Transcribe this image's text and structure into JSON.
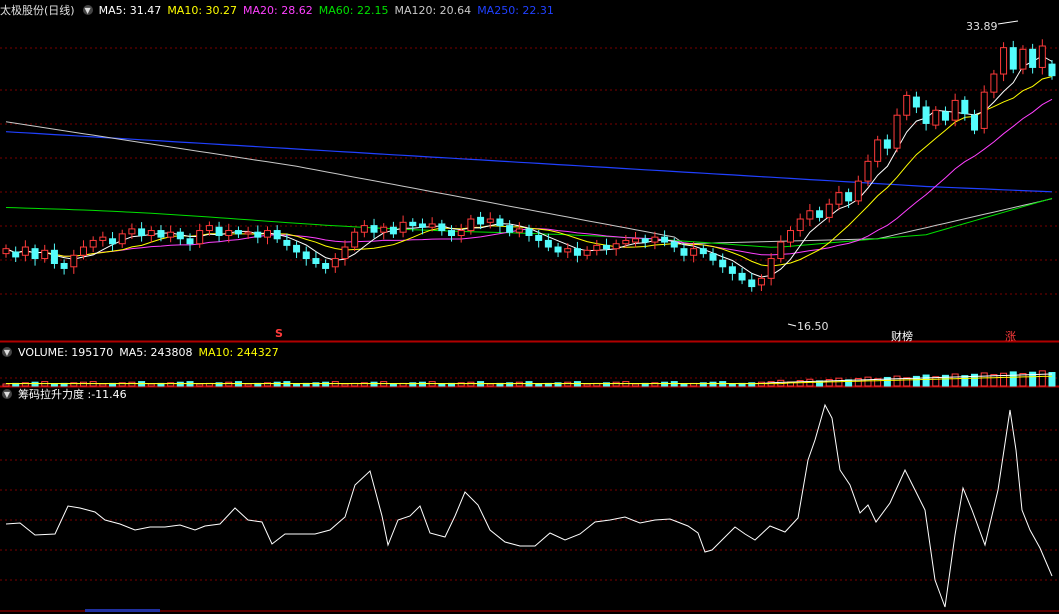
{
  "colors": {
    "up": "#ff3b3b",
    "down": "#54fcfc",
    "ma5": "#ffffff",
    "ma10": "#ffff00",
    "ma20": "#ff40ff",
    "ma60": "#00e000",
    "ma120": "#c8c8c8",
    "ma250": "#2040ff",
    "grid": "#7a0000",
    "separator": "#b00000",
    "osc": "#ffffff"
  },
  "price_panel": {
    "stock_name": "太极股份(日线)",
    "ma_labels": [
      {
        "key": "ma5",
        "text": "MA5: 31.47"
      },
      {
        "key": "ma10",
        "text": "MA10: 30.27"
      },
      {
        "key": "ma20",
        "text": "MA20: 28.62"
      },
      {
        "key": "ma60",
        "text": "MA60: 22.15"
      },
      {
        "key": "ma120",
        "text": "MA120: 20.64"
      },
      {
        "key": "ma250",
        "text": "MA250: 22.31"
      }
    ],
    "high_label": "33.89",
    "low_label": "16.50",
    "markers": [
      {
        "text": "S",
        "color": "#ff3b3b"
      },
      {
        "text": "财榜",
        "color": "#ffffff"
      },
      {
        "text": "涨",
        "color": "#ff3b3b"
      }
    ]
  },
  "volume_panel": {
    "labels": [
      {
        "key": "vol",
        "text": "VOLUME: 195170"
      },
      {
        "key": "ma5",
        "text": "MA5: 243808"
      },
      {
        "key": "ma10",
        "text": "MA10: 244327"
      }
    ]
  },
  "indicator_panel": {
    "label": "筹码拉升力度 :-11.46"
  },
  "chart_data": {
    "type": "candlestick",
    "title": "太极股份(日线)",
    "ylim": [
      15.5,
      34.8
    ],
    "high_point": 33.89,
    "low_point": 16.5,
    "candles": [
      [
        20.5,
        20.8
      ],
      [
        20.6,
        20.3
      ],
      [
        20.4,
        20.9
      ],
      [
        20.8,
        20.2
      ],
      [
        20.2,
        20.7
      ],
      [
        20.7,
        19.9
      ],
      [
        19.9,
        19.6
      ],
      [
        19.7,
        20.4
      ],
      [
        20.4,
        20.9
      ],
      [
        20.9,
        21.3
      ],
      [
        21.3,
        21.5
      ],
      [
        21.4,
        21.1
      ],
      [
        21.1,
        21.7
      ],
      [
        21.7,
        22.0
      ],
      [
        22.0,
        21.6
      ],
      [
        21.6,
        21.9
      ],
      [
        21.9,
        21.5
      ],
      [
        21.5,
        21.8
      ],
      [
        21.8,
        21.4
      ],
      [
        21.4,
        21.1
      ],
      [
        21.1,
        21.9
      ],
      [
        21.9,
        22.2
      ],
      [
        22.1,
        21.6
      ],
      [
        21.6,
        21.9
      ],
      [
        21.9,
        21.7
      ],
      [
        21.7,
        21.8
      ],
      [
        21.8,
        21.5
      ],
      [
        21.5,
        21.9
      ],
      [
        21.9,
        21.4
      ],
      [
        21.3,
        21.0
      ],
      [
        21.0,
        20.6
      ],
      [
        20.6,
        20.2
      ],
      [
        20.2,
        19.9
      ],
      [
        19.9,
        19.6
      ],
      [
        19.7,
        20.2
      ],
      [
        20.2,
        20.9
      ],
      [
        20.9,
        21.8
      ],
      [
        21.8,
        22.2
      ],
      [
        22.2,
        21.8
      ],
      [
        21.8,
        22.1
      ],
      [
        22.1,
        21.7
      ],
      [
        21.8,
        22.4
      ],
      [
        22.4,
        22.2
      ],
      [
        22.3,
        22.1
      ],
      [
        22.1,
        22.3
      ],
      [
        22.3,
        21.9
      ],
      [
        21.9,
        21.6
      ],
      [
        21.6,
        21.9
      ],
      [
        21.9,
        22.6
      ],
      [
        22.7,
        22.3
      ],
      [
        22.4,
        22.6
      ],
      [
        22.6,
        22.2
      ],
      [
        22.2,
        21.8
      ],
      [
        21.8,
        22.0
      ],
      [
        22.0,
        21.6
      ],
      [
        21.6,
        21.3
      ],
      [
        21.3,
        20.9
      ],
      [
        20.9,
        20.6
      ],
      [
        20.6,
        20.8
      ],
      [
        20.8,
        20.4
      ],
      [
        20.4,
        20.7
      ],
      [
        20.7,
        21.0
      ],
      [
        21.0,
        20.8
      ],
      [
        20.8,
        21.1
      ],
      [
        21.1,
        21.3
      ],
      [
        21.2,
        21.4
      ],
      [
        21.4,
        21.2
      ],
      [
        21.2,
        21.5
      ],
      [
        21.5,
        21.2
      ],
      [
        21.2,
        20.9
      ],
      [
        20.8,
        20.4
      ],
      [
        20.4,
        20.8
      ],
      [
        20.8,
        20.5
      ],
      [
        20.5,
        20.1
      ],
      [
        20.1,
        19.7
      ],
      [
        19.7,
        19.3
      ],
      [
        19.3,
        18.9
      ],
      [
        18.9,
        18.5
      ],
      [
        18.6,
        19.0
      ],
      [
        19.0,
        20.2
      ],
      [
        20.2,
        21.2
      ],
      [
        21.2,
        21.9
      ],
      [
        21.9,
        22.6
      ],
      [
        22.6,
        23.1
      ],
      [
        23.1,
        22.7
      ],
      [
        22.7,
        23.5
      ],
      [
        23.5,
        24.2
      ],
      [
        24.2,
        23.7
      ],
      [
        23.7,
        24.9
      ],
      [
        24.9,
        26.1
      ],
      [
        26.1,
        27.4
      ],
      [
        27.4,
        26.9
      ],
      [
        26.9,
        28.9
      ],
      [
        28.9,
        30.1
      ],
      [
        30.0,
        29.4
      ],
      [
        29.4,
        28.4
      ],
      [
        28.3,
        29.2
      ],
      [
        29.1,
        28.6
      ],
      [
        28.6,
        29.8
      ],
      [
        29.8,
        29.0
      ],
      [
        28.9,
        28.0
      ],
      [
        28.1,
        30.3
      ],
      [
        30.3,
        31.4
      ],
      [
        31.4,
        33.0
      ],
      [
        33.0,
        31.7
      ],
      [
        31.7,
        32.9
      ],
      [
        32.9,
        31.8
      ],
      [
        31.8,
        33.1
      ],
      [
        32.0,
        31.3
      ]
    ]
  }
}
